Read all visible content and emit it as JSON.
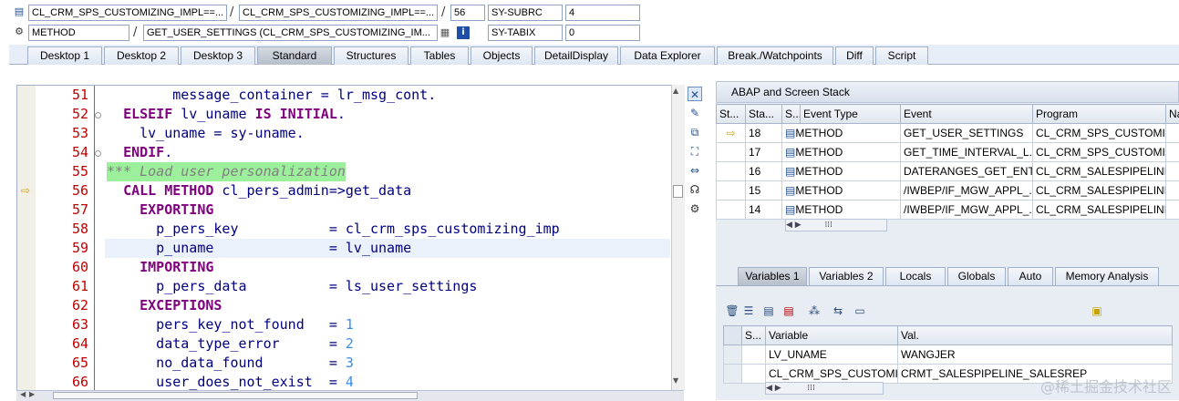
{
  "top": {
    "row1": {
      "field1": "CL_CRM_SPS_CUSTOMIZING_IMPL==...",
      "field2": "CL_CRM_SPS_CUSTOMIZING_IMPL==...",
      "line": "56",
      "sysvar": "SY-SUBRC",
      "sysval": "4"
    },
    "row2": {
      "type": "METHOD",
      "name": "GET_USER_SETTINGS (CL_CRM_SPS_CUSTOMIZING_IM...",
      "sysvar": "SY-TABIX",
      "sysval": "0"
    }
  },
  "tabs": [
    "Desktop 1",
    "Desktop 2",
    "Desktop 3",
    "Standard",
    "Structures",
    "Tables",
    "Objects",
    "DetailDisplay",
    "Data Explorer",
    "Break./Watchpoints",
    "Diff",
    "Script"
  ],
  "active_tab": "Standard",
  "code_lines": [
    {
      "n": "51",
      "text": "        message_container = lr_msg_cont."
    },
    {
      "n": "52",
      "text": "  ELSEIF lv_uname IS INITIAL."
    },
    {
      "n": "53",
      "text": "    lv_uname = sy-uname."
    },
    {
      "n": "54",
      "text": "  ENDIF."
    },
    {
      "n": "55",
      "text": "*** Load user personalization"
    },
    {
      "n": "56",
      "text": "  CALL METHOD cl_pers_admin=>get_data"
    },
    {
      "n": "57",
      "text": "    EXPORTING"
    },
    {
      "n": "58",
      "text": "      p_pers_key           = cl_crm_sps_customizing_imp"
    },
    {
      "n": "59",
      "text": "      p_uname              = lv_uname"
    },
    {
      "n": "60",
      "text": "    IMPORTING"
    },
    {
      "n": "61",
      "text": "      p_pers_data          = ls_user_settings"
    },
    {
      "n": "62",
      "text": "    EXCEPTIONS"
    },
    {
      "n": "63",
      "text": "      pers_key_not_found   = 1"
    },
    {
      "n": "64",
      "text": "      data_type_error      = 2"
    },
    {
      "n": "65",
      "text": "      no_data_found        = 3"
    },
    {
      "n": "66",
      "text": "      user_does_not_exist  = 4"
    }
  ],
  "stack": {
    "title": "ABAP and Screen Stack",
    "columns": [
      "St...",
      "Sta...",
      "S...",
      "Event Type",
      "Event",
      "Program",
      "Na"
    ],
    "rows": [
      {
        "level": "18",
        "type": "METHOD",
        "event": "GET_USER_SETTINGS",
        "program": "CL_CRM_SPS_CUSTOMIZ..."
      },
      {
        "level": "17",
        "type": "METHOD",
        "event": "GET_TIME_INTERVAL_L...",
        "program": "CL_CRM_SPS_CUSTOMIZ..."
      },
      {
        "level": "16",
        "type": "METHOD",
        "event": "DATERANGES_GET_ENT...",
        "program": "CL_CRM_SALESPIPELINE..."
      },
      {
        "level": "15",
        "type": "METHOD",
        "event": "/IWBEP/IF_MGW_APPL_...",
        "program": "CL_CRM_SALESPIPELINE..."
      },
      {
        "level": "14",
        "type": "METHOD",
        "event": "/IWBEP/IF_MGW_APPL_...",
        "program": "CL_CRM_SALESPIPELINE..."
      }
    ]
  },
  "var_tabs": [
    "Variables 1",
    "Variables 2",
    "Locals",
    "Globals",
    "Auto",
    "Memory Analysis"
  ],
  "variables": {
    "columns": [
      "S...",
      "Variable",
      "Val."
    ],
    "rows": [
      {
        "name": "LV_UNAME",
        "value": "WANGJER"
      },
      {
        "name": "CL_CRM_SPS_CUSTOMIZ...",
        "value": "CRMT_SALESPIPELINE_SALESREP"
      }
    ]
  },
  "watermark": "@稀土掘金技术社区"
}
